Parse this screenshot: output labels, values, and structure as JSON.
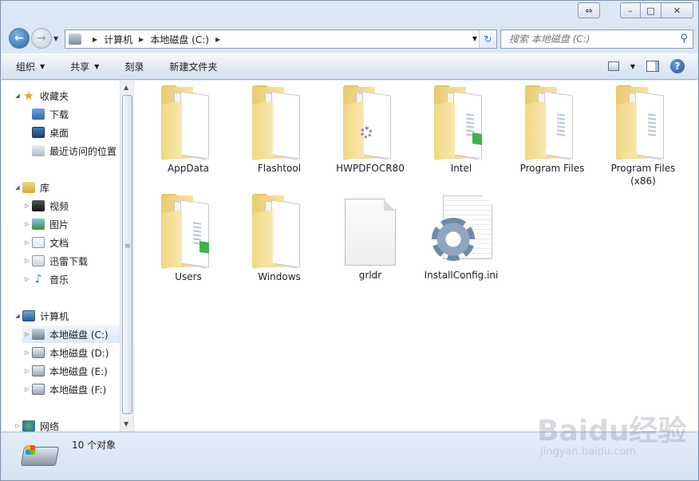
{
  "window": {
    "controls": {
      "swap": "⇔",
      "minimize": "–",
      "maximize": "□",
      "close": "✕"
    }
  },
  "address": {
    "crumbs": [
      "计算机",
      "本地磁盘 (C:)"
    ],
    "search_placeholder": "搜索 本地磁盘 (C:)"
  },
  "toolbar": {
    "organize": "组织",
    "share": "共享",
    "burn": "刻录",
    "new_folder": "新建文件夹",
    "help": "?"
  },
  "sidebar": {
    "items": [
      {
        "label": "收藏夹",
        "icon": "star-icon"
      },
      {
        "label": "下载",
        "icon": "downloads-icon"
      },
      {
        "label": "桌面",
        "icon": "desktop-icon"
      },
      {
        "label": "最近访问的位置",
        "icon": "recent-places-icon"
      },
      {
        "label": "库",
        "icon": "library-icon"
      },
      {
        "label": "视频",
        "icon": "video-icon"
      },
      {
        "label": "图片",
        "icon": "pictures-icon"
      },
      {
        "label": "文档",
        "icon": "documents-icon"
      },
      {
        "label": "迅雷下载",
        "icon": "xunlei-icon"
      },
      {
        "label": "音乐",
        "icon": "music-icon"
      },
      {
        "label": "计算机",
        "icon": "computer-icon"
      },
      {
        "label": "本地磁盘 (C:)",
        "icon": "drive-c-icon"
      },
      {
        "label": "本地磁盘 (D:)",
        "icon": "drive-icon"
      },
      {
        "label": "本地磁盘 (E:)",
        "icon": "drive-icon"
      },
      {
        "label": "本地磁盘 (F:)",
        "icon": "drive-icon"
      },
      {
        "label": "网络",
        "icon": "network-icon"
      }
    ]
  },
  "files": [
    {
      "name": "AppData",
      "type": "folder"
    },
    {
      "name": "Flashtool",
      "type": "folder"
    },
    {
      "name": "HWPDFOCR80",
      "type": "folder"
    },
    {
      "name": "Intel",
      "type": "folder"
    },
    {
      "name": "Program Files",
      "type": "folder"
    },
    {
      "name": "Program Files (x86)",
      "type": "folder"
    },
    {
      "name": "Users",
      "type": "folder"
    },
    {
      "name": "Windows",
      "type": "folder"
    },
    {
      "name": "grldr",
      "type": "file"
    },
    {
      "name": "InstallConfig.ini",
      "type": "ini"
    }
  ],
  "status": {
    "count": "10 个对象"
  },
  "watermark": {
    "brand": "Baidu经验",
    "url": "jingyan.baidu.com"
  }
}
